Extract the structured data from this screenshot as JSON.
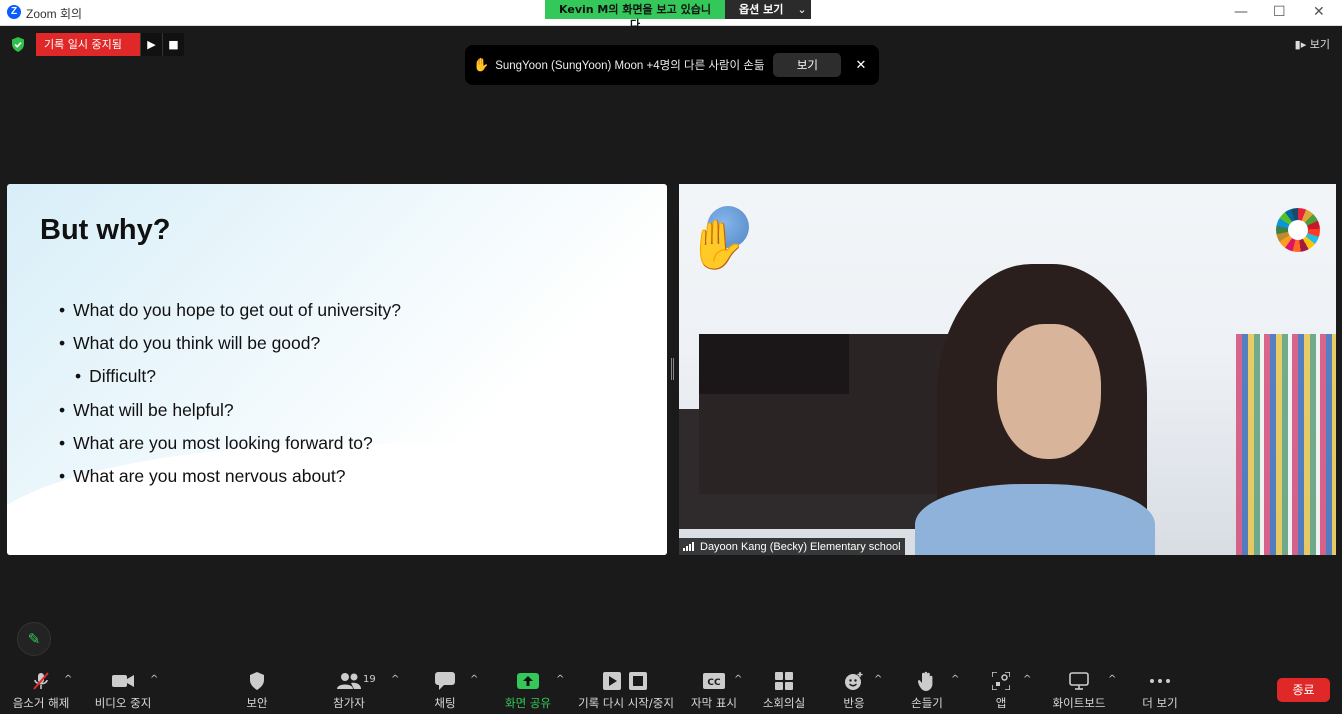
{
  "window": {
    "title": "Zoom 회의"
  },
  "share_banner": {
    "status": "Kevin M의 화면을 보고 있습니다",
    "options_label": "옵션 보기"
  },
  "recording": {
    "status": "기록 일시 중지됨"
  },
  "view_button": {
    "label": "보기"
  },
  "hand_notice": {
    "text": "SungYoon (SungYoon) Moon +4명의 다른 사람이 손듦",
    "view_label": "보기"
  },
  "slide": {
    "title": "But why?",
    "bullets": [
      "What do you hope to get out of university?",
      "What do you think will be good?",
      "Difficult?",
      "What will be helpful?",
      "What are you most looking forward to?",
      "What are you most nervous about?"
    ]
  },
  "participant": {
    "name": "Dayoon Kang (Becky) Elementary school"
  },
  "toolbar": {
    "unmute": "음소거 해제",
    "stop_video": "비디오 중지",
    "security": "보안",
    "participants": "참가자",
    "participants_count": "19",
    "chat": "채팅",
    "share_screen": "화면 공유",
    "record": "기록 다시 시작/중지",
    "captions": "자막 표시",
    "breakout": "소회의실",
    "reactions": "반응",
    "raise_hand": "손들기",
    "apps": "앱",
    "whiteboard": "화이트보드",
    "more": "더 보기",
    "end": "종료"
  },
  "colors": {
    "recording_red": "#e02828",
    "share_green": "#34c759",
    "zoom_blue": "#0b5cff"
  }
}
